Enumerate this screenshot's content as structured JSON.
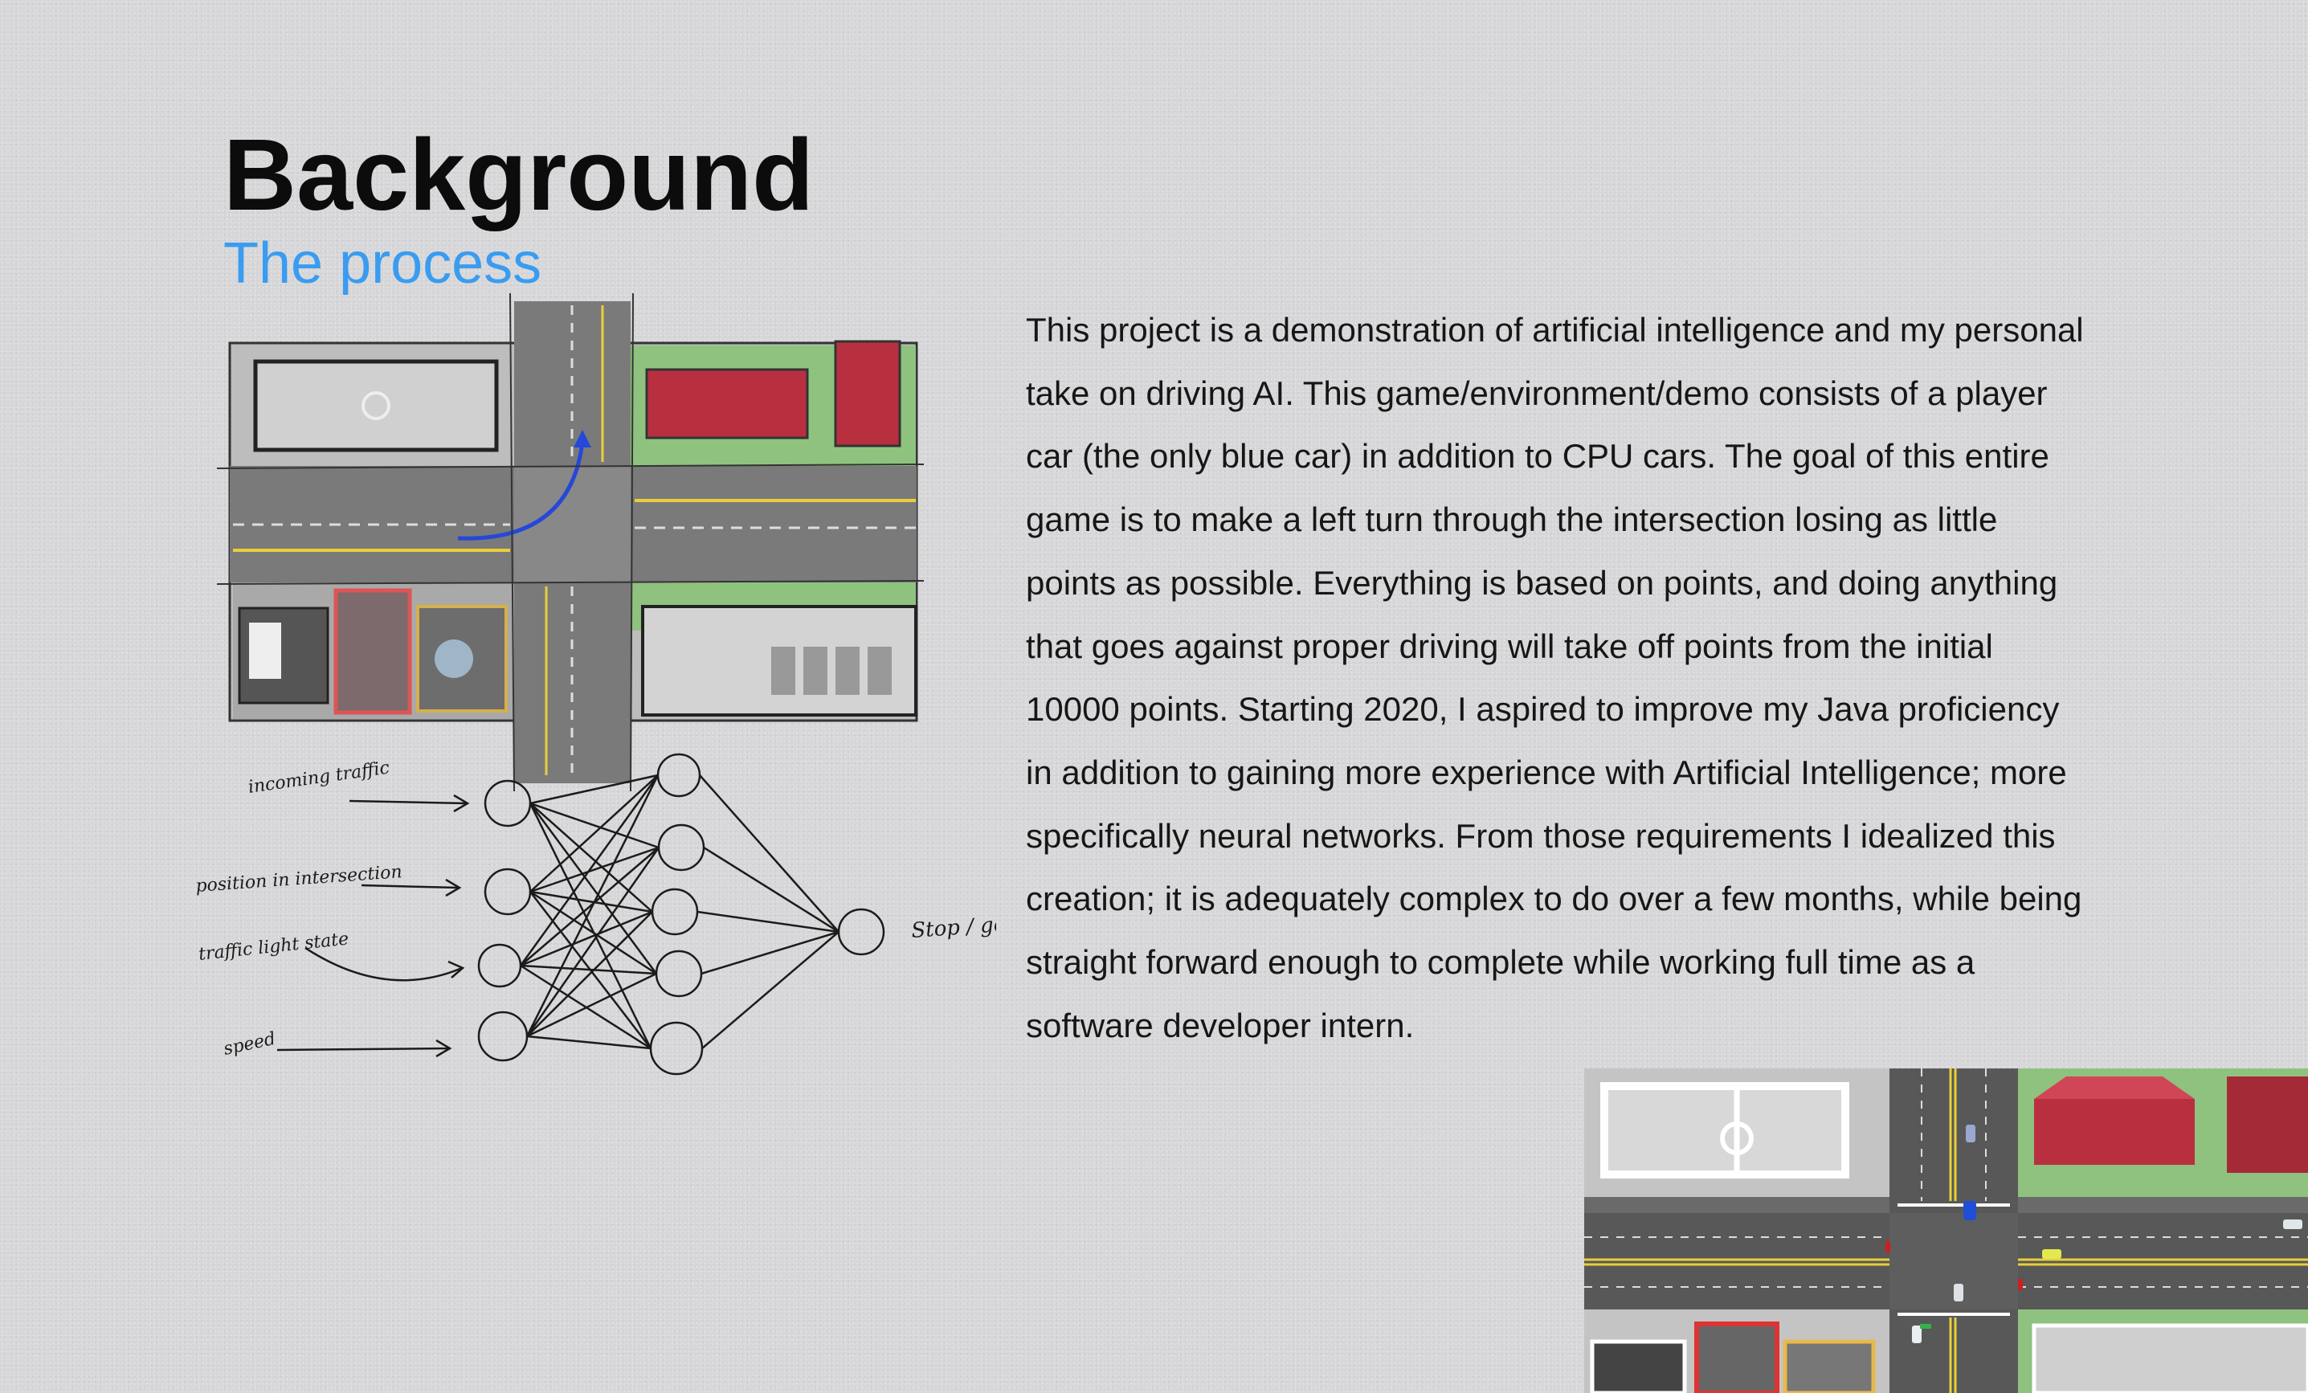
{
  "slide": {
    "title": "Background",
    "subtitle": "The process",
    "body": "This project is a demonstration of artificial intelligence and my personal take on driving AI. This game/environment/demo consists of a player car (the only blue car) in addition to CPU cars. The goal of this entire game is to make a left turn through the intersection losing as little points as possible. Everything is based on points, and doing anything that goes against proper driving will take off points from the initial 10000 points. Starting 2020, I aspired to improve my Java proficiency in addition to gaining more experience with Artificial Intelligence; more specifically neural networks. From those requirements I idealized this creation; it is adequately complex to do over a few months, while being straight forward enough to complete while working full time as a software developer intern."
  },
  "sketch": {
    "inputs": [
      "incoming traffic",
      "position in intersection",
      "traffic light state",
      "speed"
    ],
    "output": "Stop / go"
  },
  "colors": {
    "title": "#0c0c0c",
    "subtitle": "#3a9cf0",
    "road": "#585858",
    "grass": "#8fc27f",
    "building_red": "#b83040",
    "lane_yellow": "#e8cf3a",
    "player_car": "#1f4fd6"
  }
}
